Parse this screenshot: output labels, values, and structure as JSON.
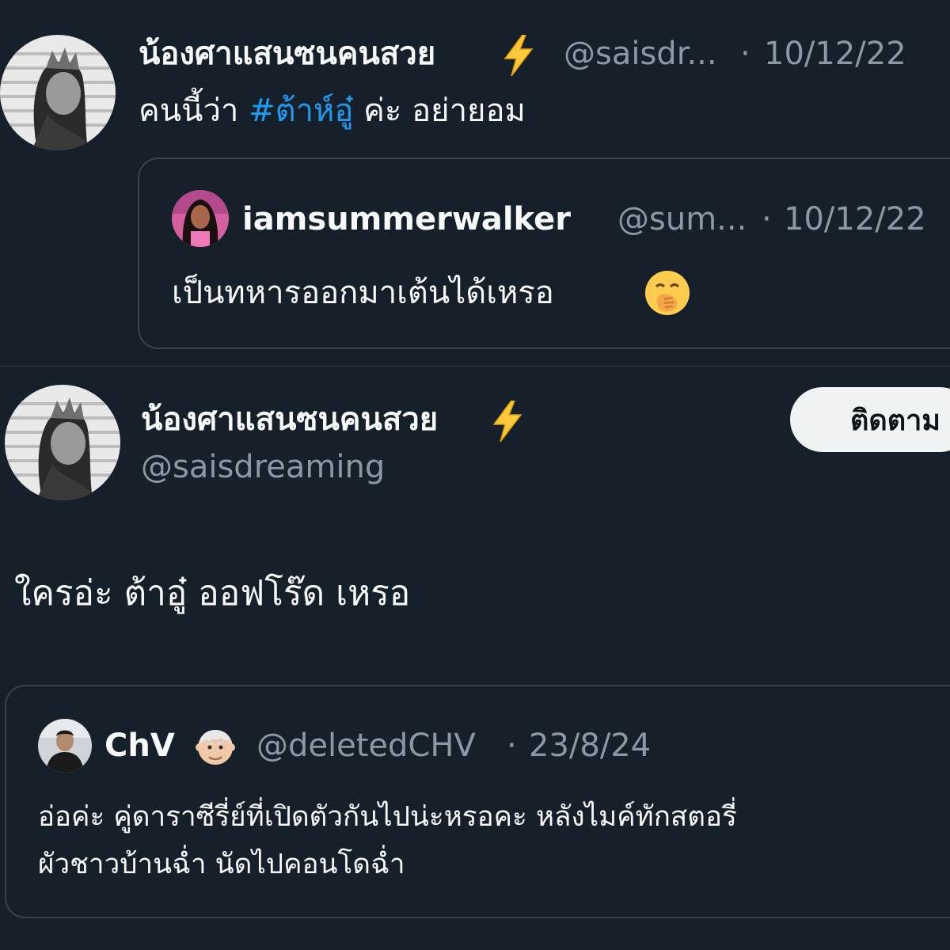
{
  "tweet1": {
    "display_name": "น้องศาแสนซนคนสวย",
    "name_emoji": "⚡",
    "handle": "@saisdr...",
    "dot": "·",
    "date": "10/12/22",
    "text_before": "คนนี้ว่า",
    "hashtag": "#ต้าห์อู๋",
    "text_after": "ค่ะ อย่ายอม",
    "avatar_icon": "profile-photo-icon"
  },
  "quoted1": {
    "display_name": "iamsummerwalker",
    "handle": "@sum...",
    "dot": "·",
    "date": "10/12/22",
    "text": "เป็นทหารออกมาเต้นได้เหรอ",
    "emoji_icon": "face-with-hand-over-mouth-icon"
  },
  "tweet2": {
    "display_name": "น้องศาแสนซนคนสวย",
    "name_emoji": "⚡",
    "handle": "@saisdreaming",
    "follow_label": "ติดตาม",
    "text": "ใครอ่ะ ต้าอู๋ ออฟโร๊ด เหรอ"
  },
  "quoted2": {
    "display_name": "ChV",
    "name_emoji_icon": "old-man-emoji-icon",
    "handle": "@deletedCHV",
    "dot": "·",
    "date": "23/8/24",
    "text_line1": "อ่อค่ะ คู่ดาราซีรี่ย์ที่เปิดตัวกันไปน่ะหรอคะ หลังไมค์ทักสตอรี่",
    "text_line2": "ผัวชาวบ้านฉ่ำ นัดไปคอนโดฉ่ำ"
  },
  "colors": {
    "background": "#15202b",
    "text": "#f7f9f9",
    "muted": "#8b98a5",
    "link": "#1d9bf0",
    "border": "#38444d",
    "button_bg": "#eff3f4",
    "lightning": "#ffc93c"
  }
}
